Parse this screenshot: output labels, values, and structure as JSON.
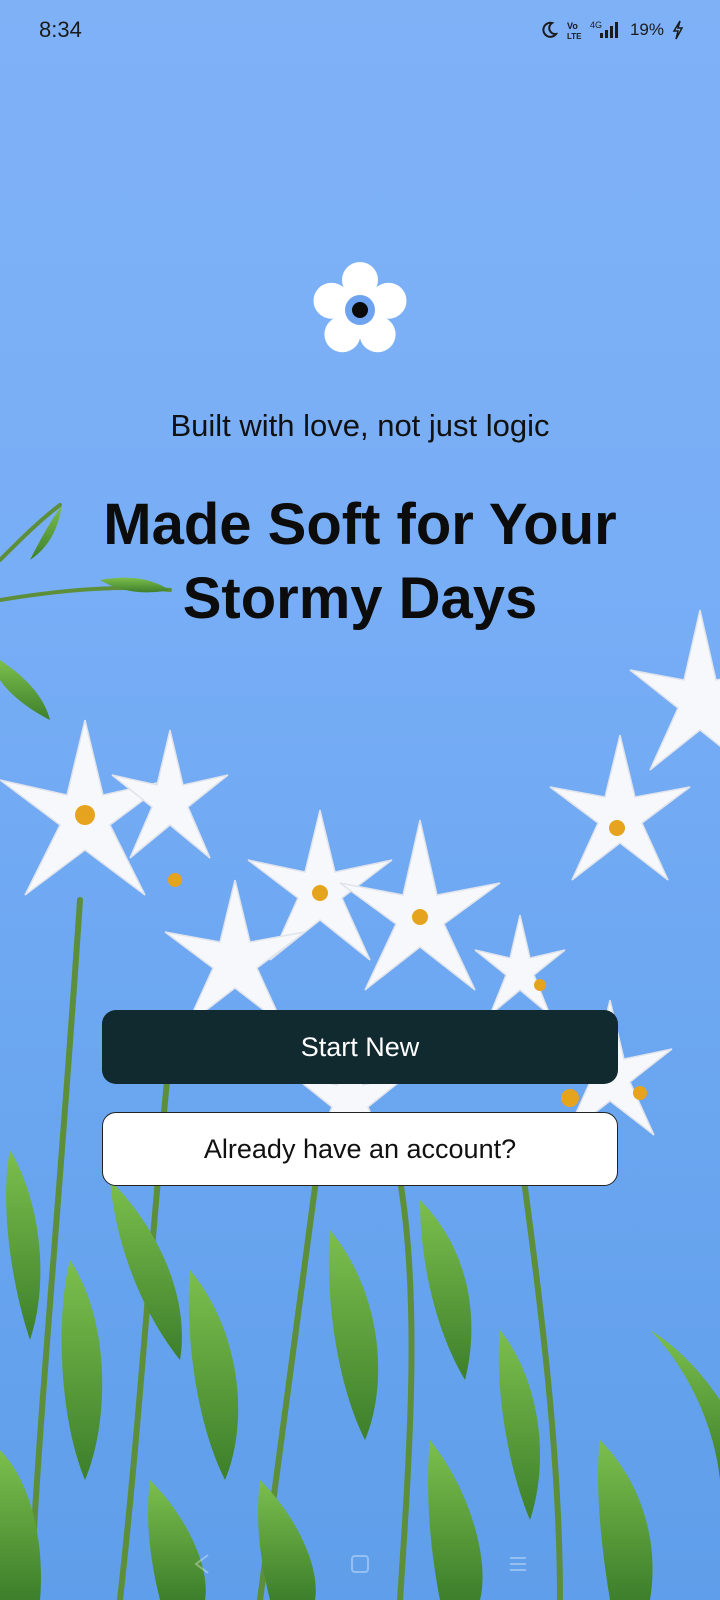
{
  "status_bar": {
    "time": "8:34",
    "battery": "19%",
    "network": "4G",
    "icons": [
      "moon-icon",
      "volte-icon",
      "signal-icon",
      "battery-charging-icon"
    ]
  },
  "logo": {
    "icon": "flower-icon",
    "colors": {
      "petals": "#ffffff",
      "ring": "#6ea3ef",
      "center": "#0a0a0a"
    }
  },
  "hero": {
    "tagline": "Built with love, not just logic",
    "headline_line1": "Made Soft for Your",
    "headline_line2": "Stormy Days"
  },
  "actions": {
    "primary_label": "Start New",
    "secondary_label": "Already have an account?"
  },
  "colors": {
    "sky": "#78aef6",
    "primary_button": "#112a30",
    "secondary_button": "#ffffff"
  }
}
